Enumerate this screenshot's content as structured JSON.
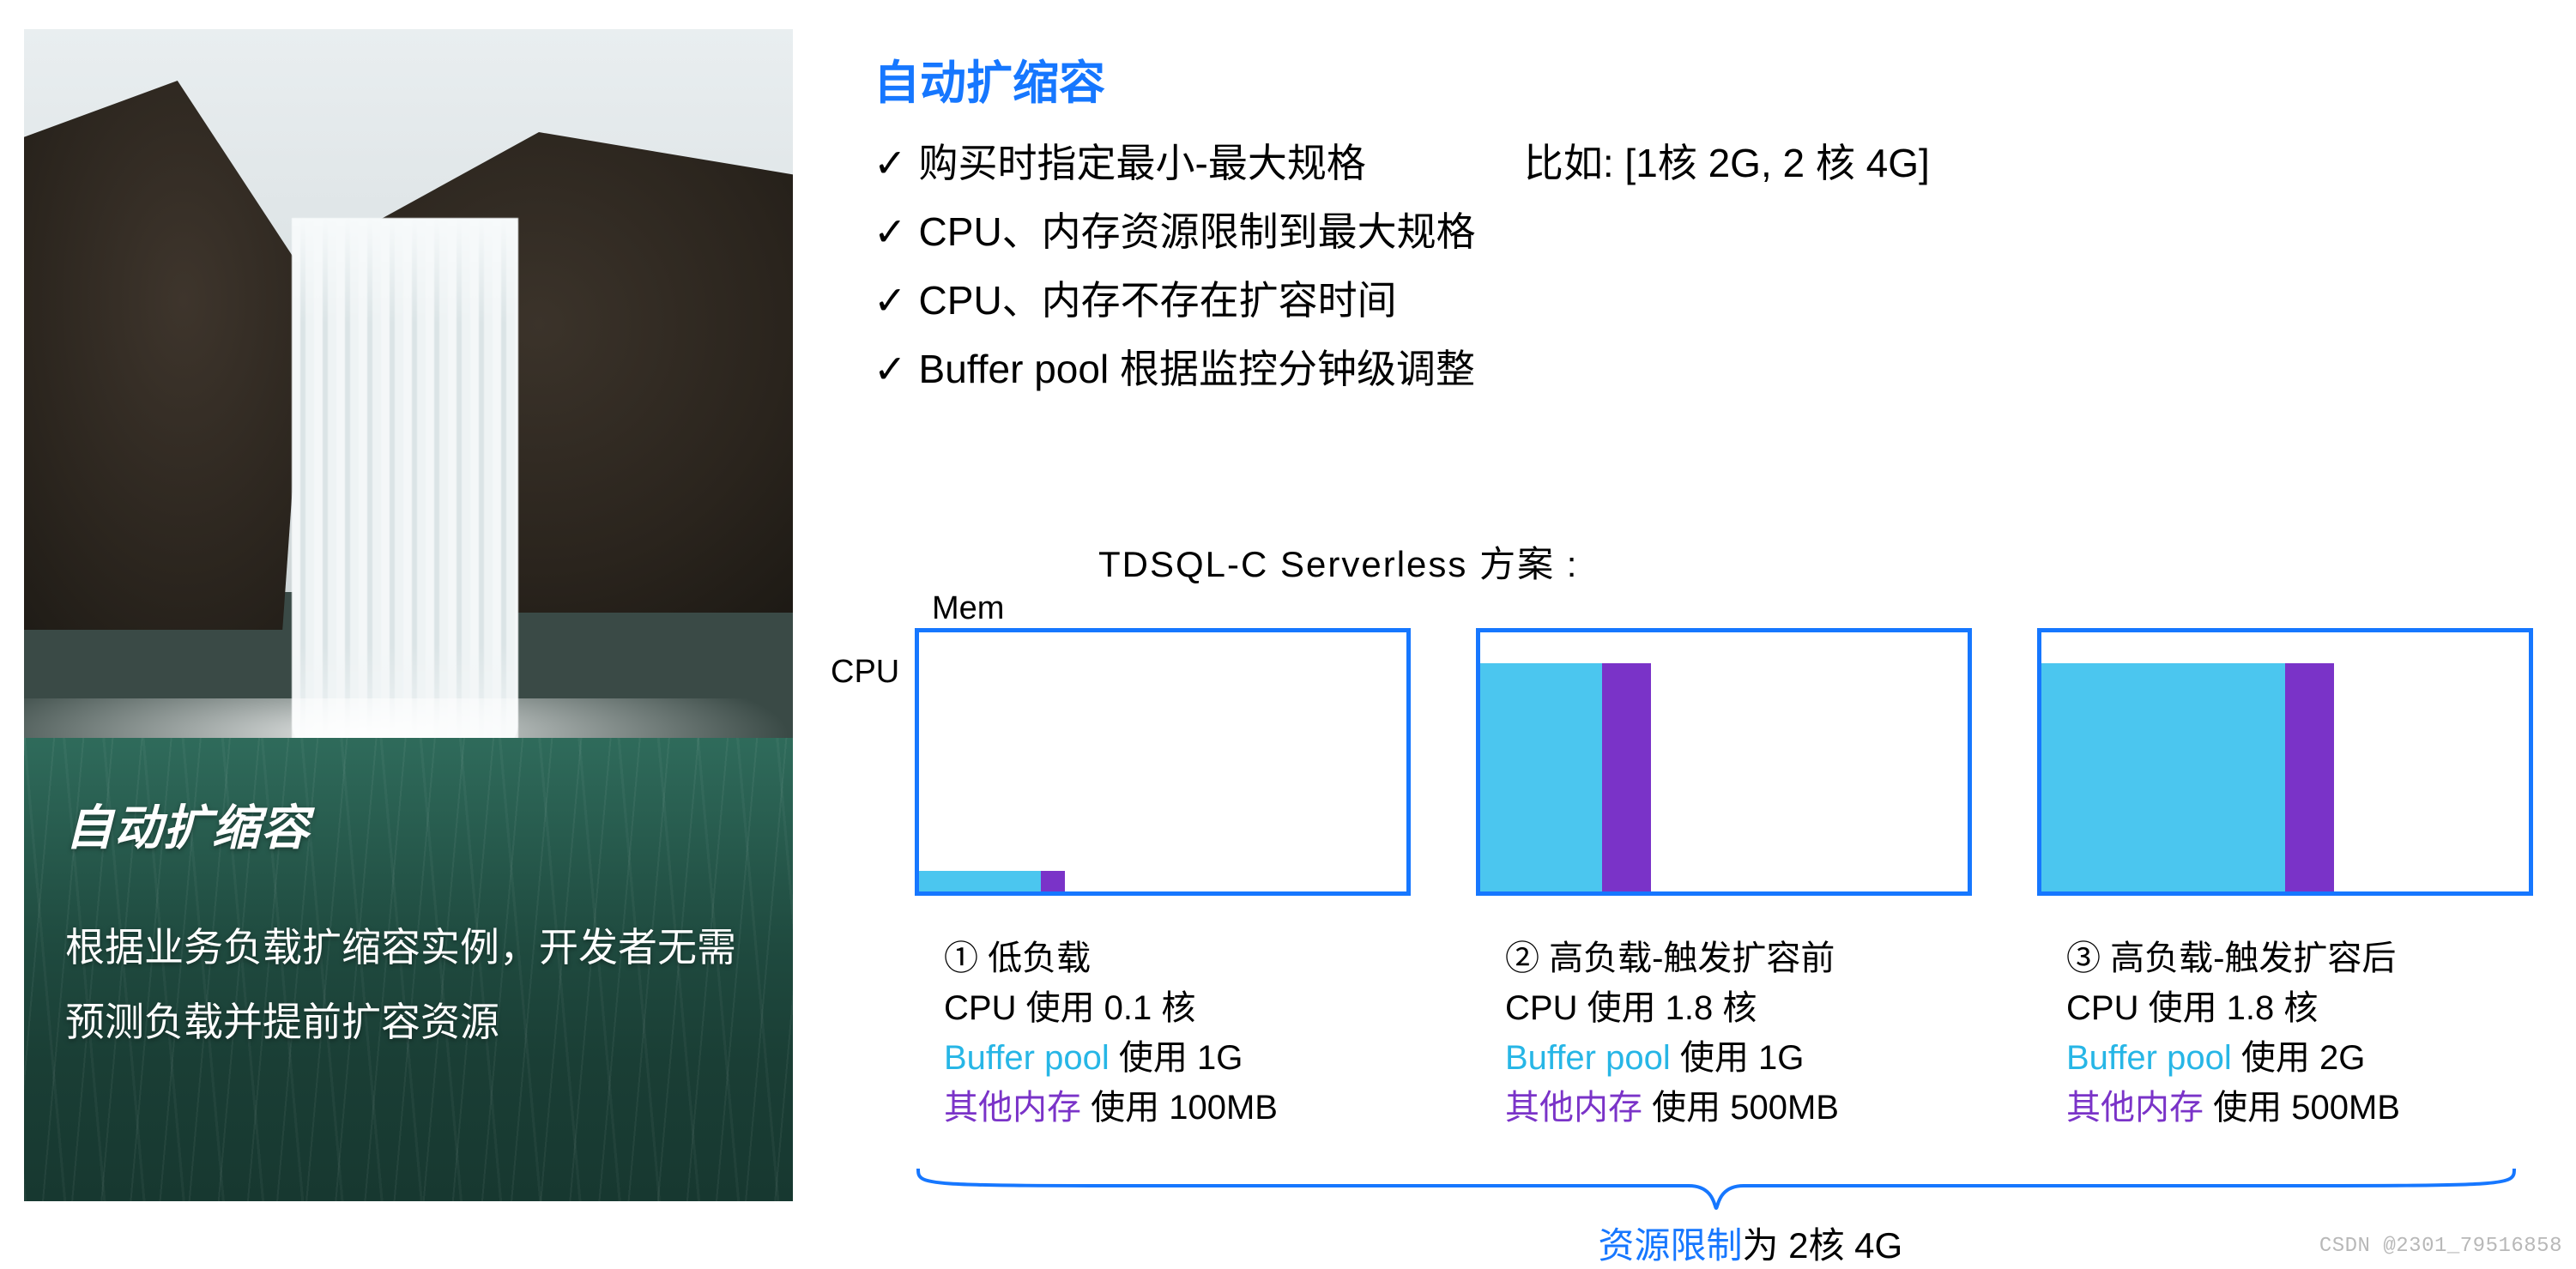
{
  "hero": {
    "title": "自动扩缩容",
    "desc": "根据业务负载扩缩容实例，开发者无需预测负载并提前扩容资源"
  },
  "heading": "自动扩缩容",
  "bullets": {
    "check": "✓",
    "b1": "购买时指定最小-最大规格",
    "b1_example": "比如: [1核 2G, 2 核 4G]",
    "b2": "CPU、内存资源限制到最大规格",
    "b3": "CPU、内存不存在扩容时间",
    "b4": "Buffer pool 根据监控分钟级调整"
  },
  "chart_title": "TDSQL-C Serverless 方案 :",
  "axes": {
    "mem": "Mem",
    "cpu": "CPU"
  },
  "captions": {
    "c1": {
      "title": "① 低负载",
      "cpu": "CPU 使用 0.1 核",
      "bp_label": "Buffer pool",
      "bp_rest": " 使用 1G",
      "oth_label": "其他内存",
      "oth_rest": " 使用 100MB"
    },
    "c2": {
      "title": "② 高负载-触发扩容前",
      "cpu": "CPU 使用 1.8 核",
      "bp_label": "Buffer pool",
      "bp_rest": " 使用 1G",
      "oth_label": "其他内存",
      "oth_rest": " 使用 500MB"
    },
    "c3": {
      "title": "③ 高负载-触发扩容后",
      "cpu": "CPU 使用 1.8 核",
      "bp_label": "Buffer pool",
      "bp_rest": " 使用 2G",
      "oth_label": "其他内存",
      "oth_rest": " 使用 500MB"
    }
  },
  "resource_limit": {
    "label": "资源限制",
    "rest": "为 2核 4G"
  },
  "watermark": "CSDN @2301_79516858",
  "colors": {
    "accent": "#1677ff",
    "cyan": "#4bc6ef",
    "purple": "#7a33c8"
  },
  "chart_data": [
    {
      "type": "bar",
      "title": "① 低负载",
      "xlabel": "CPU",
      "ylabel": "Mem",
      "categories": [
        "Buffer pool",
        "其他内存"
      ],
      "values_gb": [
        1,
        0.1
      ],
      "cpu_cores": 0.1,
      "cpu_ratio_of_max": 0.05,
      "mem_limit_gb": 4,
      "blue_w_pct": 25,
      "blue_h_pct": 8,
      "purple_w_pct": 5,
      "purple_h_pct": 8
    },
    {
      "type": "bar",
      "title": "② 高负载-触发扩容前",
      "xlabel": "CPU",
      "ylabel": "Mem",
      "categories": [
        "Buffer pool",
        "其他内存"
      ],
      "values_gb": [
        1,
        0.5
      ],
      "cpu_cores": 1.8,
      "cpu_ratio_of_max": 0.9,
      "mem_limit_gb": 4,
      "blue_w_pct": 25,
      "blue_h_pct": 88,
      "purple_w_pct": 10,
      "purple_h_pct": 88
    },
    {
      "type": "bar",
      "title": "③ 高负载-触发扩容后",
      "xlabel": "CPU",
      "ylabel": "Mem",
      "categories": [
        "Buffer pool",
        "其他内存"
      ],
      "values_gb": [
        2,
        0.5
      ],
      "cpu_cores": 1.8,
      "cpu_ratio_of_max": 0.9,
      "mem_limit_gb": 4,
      "blue_w_pct": 50,
      "blue_h_pct": 88,
      "purple_w_pct": 10,
      "purple_h_pct": 88
    }
  ]
}
